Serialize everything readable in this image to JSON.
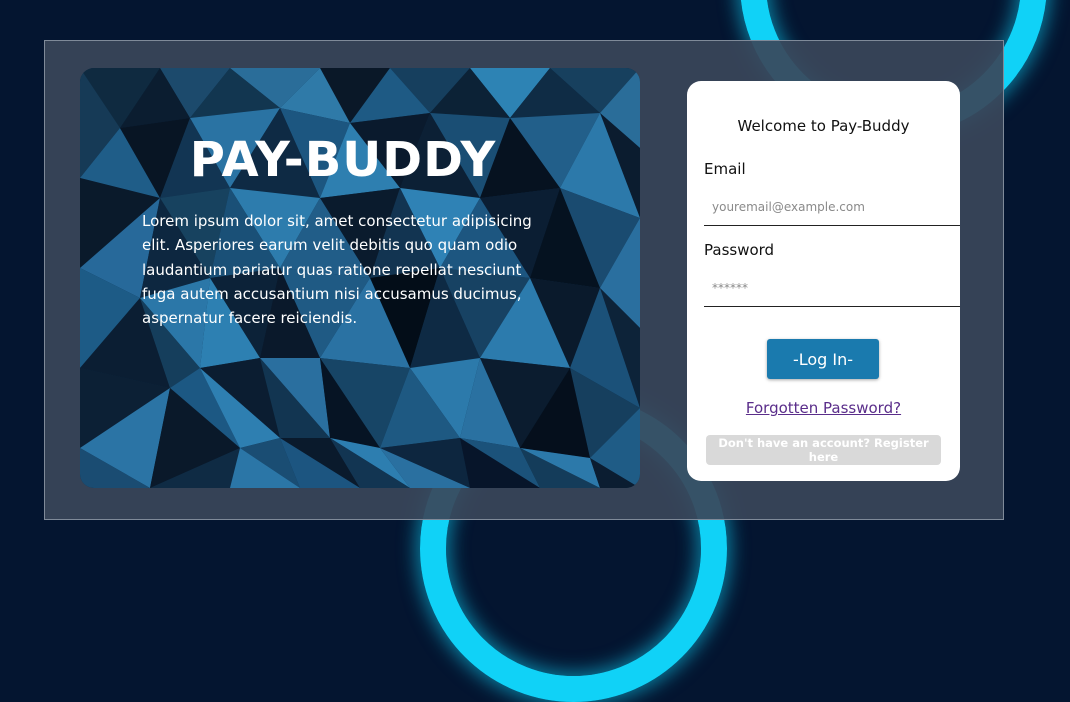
{
  "hero": {
    "title": "PAY-BUDDY",
    "description": "Lorem ipsum dolor sit, amet consectetur adipisicing elit. Asperiores earum velit debitis quo quam odio laudantium pariatur quas ratione repellat nesciunt fuga autem accusantium nisi accusamus ducimus, aspernatur facere reiciendis."
  },
  "login": {
    "welcome": "Welcome to Pay-Buddy",
    "email_label": "Email",
    "email_placeholder": "youremail@example.com",
    "password_label": "Password",
    "password_placeholder": "******",
    "login_button": "-Log In-",
    "forgot_link": "Forgotten Password?",
    "register_button": "Don't have an account? Register here"
  },
  "colors": {
    "background": "#041530",
    "ring_accent": "#10d2f7",
    "login_button": "#1a7aae",
    "link": "#5a2d8a"
  }
}
